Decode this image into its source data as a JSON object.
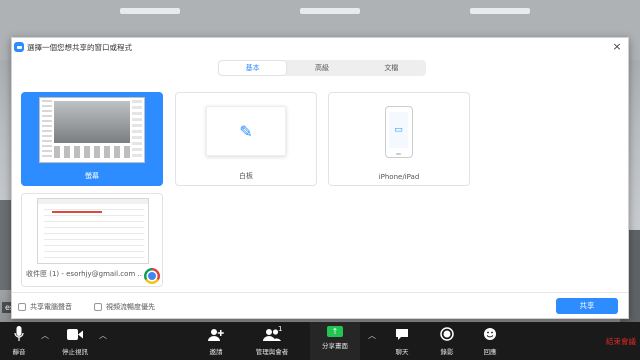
{
  "dialog": {
    "title": "選擇一個您想共享的窗口或程式",
    "close": "×",
    "tabs": [
      {
        "label": "基本",
        "active": true
      },
      {
        "label": "高級",
        "active": false
      },
      {
        "label": "文檔",
        "active": false
      }
    ],
    "options": {
      "screen": "螢幕",
      "whiteboard": "白板",
      "iphone": "iPhone/iPad",
      "mail": "收件匣 (1) - esorhjy@gmail.com ..."
    },
    "checkboxes": {
      "share_audio": "共享電腦聲音",
      "optimize_video": "視頻流暢度優先"
    },
    "share_button": "共享"
  },
  "background": {
    "username": "esc"
  },
  "toolbar": {
    "mute": "靜音",
    "stop_video": "停止視訊",
    "invite": "邀請",
    "participants": "管理與會者",
    "participant_count": "1",
    "share_screen": "分享畫面",
    "chat": "聊天",
    "record": "錄影",
    "reactions": "回應",
    "end_meeting": "結束會議"
  },
  "colors": {
    "accent": "#2d8cff",
    "share_green": "#23c552",
    "end_red": "#e02828"
  }
}
